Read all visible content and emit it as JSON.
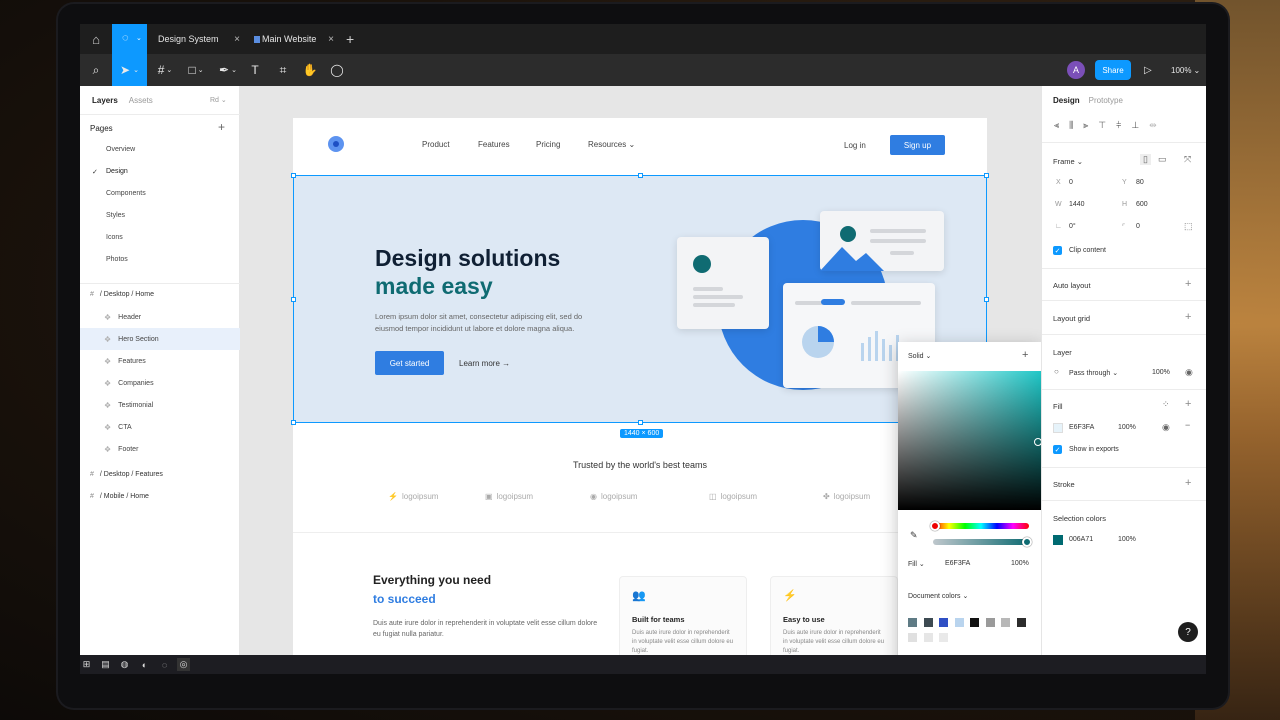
{
  "tabs": {
    "home_icon": "home-icon",
    "items": [
      {
        "label": "Design System",
        "close": "×"
      },
      {
        "label": "Main Website",
        "close": "×"
      }
    ],
    "add": "+"
  },
  "toolbar": {
    "avatar_initial": "A",
    "share_label": "Share",
    "play_icon": "▷",
    "zoom_label": "100%"
  },
  "left_panel": {
    "tab_layers": "Layers",
    "tab_assets": "Assets",
    "page_selector": "Rd ⌄",
    "pages_title": "Pages",
    "pages_add": "+",
    "pages": [
      "Overview",
      "Design",
      "Components",
      "Styles",
      "Icons",
      "Photos"
    ],
    "current_page_check": "✓",
    "frames": [
      {
        "label": "/ Desktop / Home",
        "children": [
          "Header",
          "Hero Section",
          "Features",
          "Companies",
          "Testimonial",
          "CTA",
          "Footer"
        ]
      },
      {
        "label": "/ Desktop / Features"
      },
      {
        "label": "/ Mobile / Home"
      }
    ]
  },
  "site": {
    "nav": [
      "Product",
      "Features",
      "Pricing",
      "Resources ⌄"
    ],
    "login": "Log in",
    "signup": "Sign up",
    "hero_title_1": "Design solutions",
    "hero_title_2": "made easy",
    "hero_text": "Lorem ipsum dolor sit amet, consectetur adipiscing elit, sed do eiusmod tempor incididunt ut labore et dolore magna aliqua.",
    "hero_cta": "Get started",
    "hero_more": "Learn more →",
    "frame_size": "1440 × 600",
    "trusted": "Trusted by the world's best teams",
    "logos": [
      "logoipsum",
      "logoipsum",
      "logoipsum",
      "logoipsum",
      "logoipsum"
    ],
    "everything_1": "Everything you need",
    "everything_2": "to succeed",
    "everything_text": "Duis aute irure dolor in reprehenderit in voluptate velit esse cillum dolore eu fugiat nulla pariatur.",
    "features": [
      {
        "title": "Built for teams",
        "text": "Duis aute irure dolor in reprehenderit in voluptate velit esse cillum dolore eu fugiat."
      },
      {
        "title": "Easy to use",
        "text": "Duis aute irure dolor in reprehenderit in voluptate velit esse cillum dolore eu fugiat."
      }
    ]
  },
  "color_picker": {
    "mode": "Solid ⌄",
    "add": "+",
    "fill_label": "Fill ⌄",
    "hex": "E6F3FA",
    "opacity": "100%",
    "document_colors": "Document colors ⌄",
    "swatches": [
      "#5f7b85",
      "#3d4a52",
      "#2f4fc4",
      "#b9d4ee",
      "#111111",
      "#9a9a9a",
      "#b8b8b8",
      "#2c2c2c",
      "#e0e0e0",
      "#e6e6e6",
      "#e9e9e9"
    ]
  },
  "right_panel": {
    "tab_design": "Design",
    "tab_prototype": "Prototype",
    "frame_label": "Frame ⌄",
    "x_label": "X",
    "x": "0",
    "y_label": "Y",
    "y": "80",
    "w_label": "W",
    "w": "1440",
    "h_label": "H",
    "h": "600",
    "rotation": "0°",
    "radius": "0",
    "clip_content": "Clip content",
    "auto_layout": "Auto layout",
    "layout_grid": "Layout grid",
    "layer": "Layer",
    "pass_through": "Pass through ⌄",
    "layer_opacity": "100%",
    "fill": "Fill",
    "fill_hex": "E6F3FA",
    "fill_opacity": "100%",
    "show_exports": "Show in exports",
    "stroke": "Stroke",
    "selection_colors": "Selection colors",
    "sel_hex": "006A71",
    "sel_opacity": "100%",
    "help": "?"
  },
  "colors": {
    "accent": "#0d99ff",
    "teal": "#0f6b72",
    "hero_bg": "#dde8f4"
  }
}
